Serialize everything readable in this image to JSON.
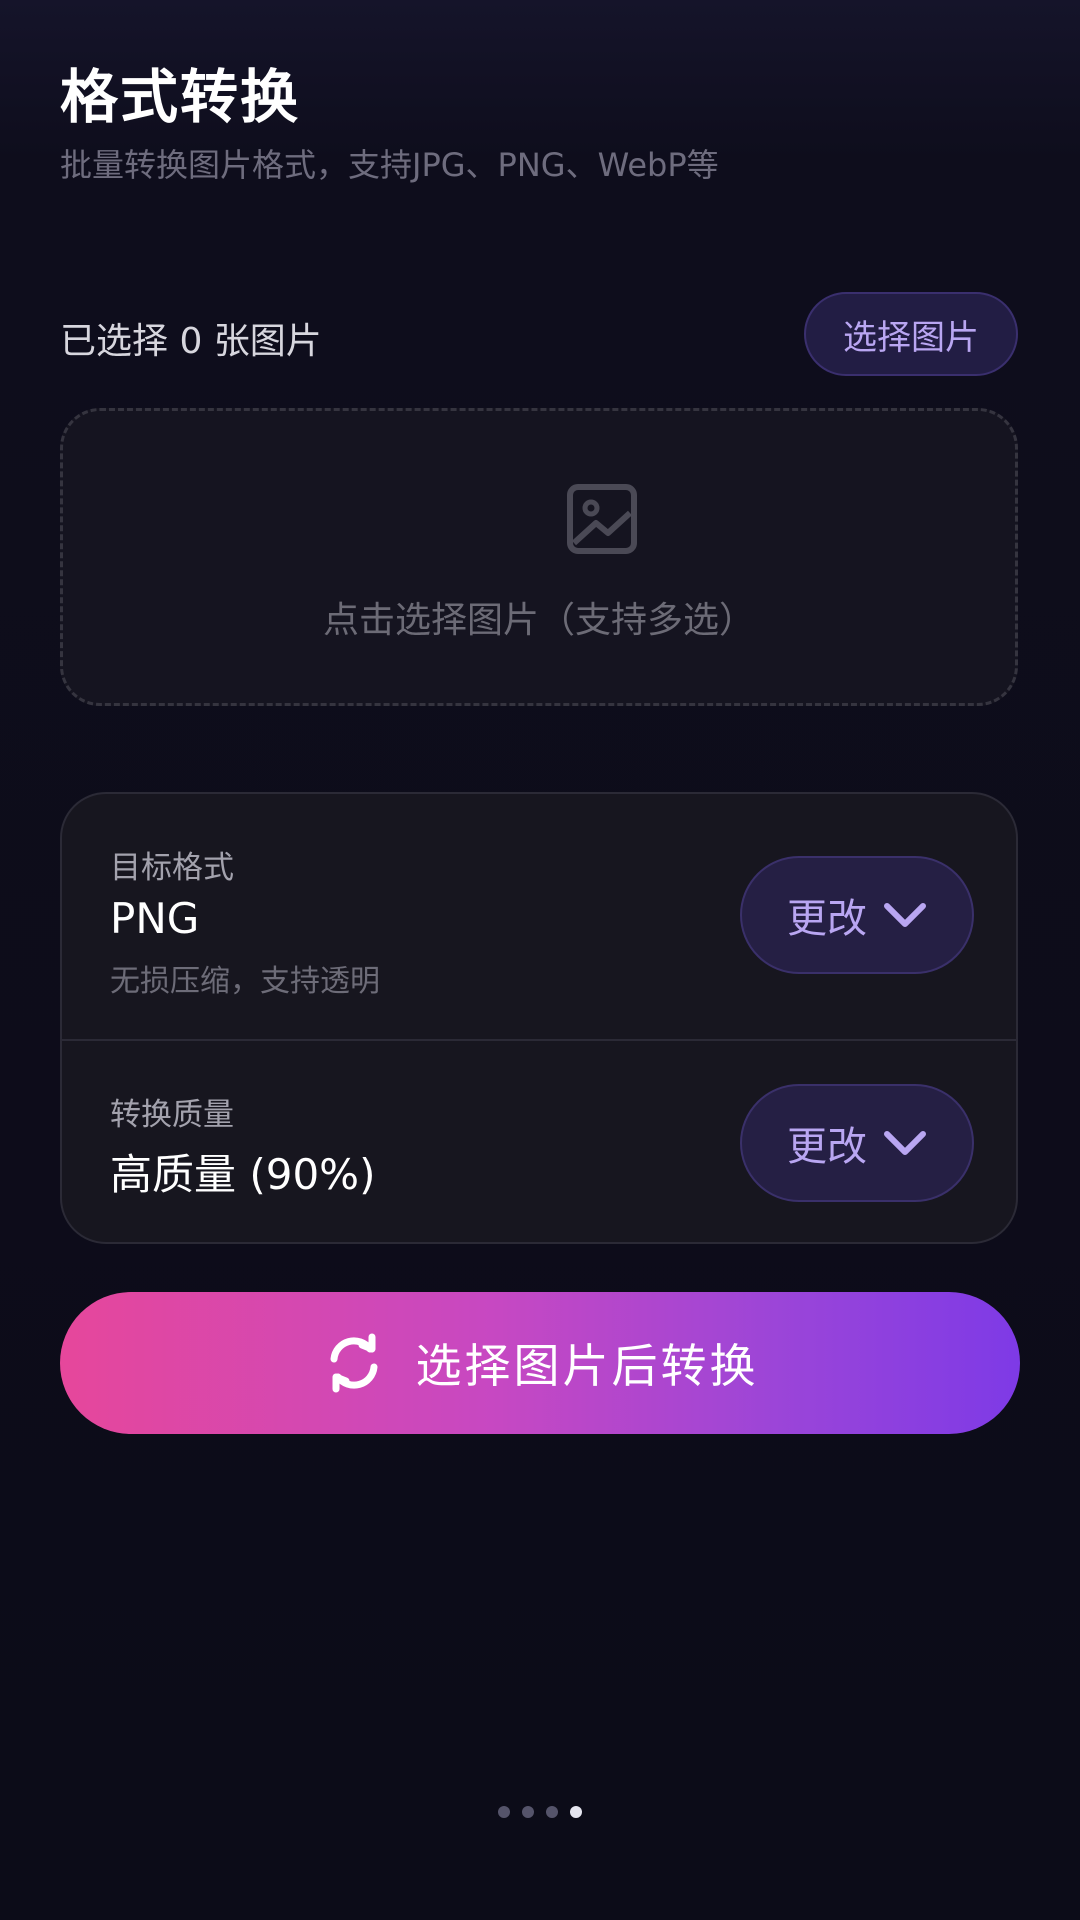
{
  "header": {
    "title": "格式转换",
    "subtitle": "批量转换图片格式，支持JPG、PNG、WebP等"
  },
  "selection": {
    "count_label": "已选择 0 张图片",
    "select_button": "选择图片"
  },
  "dropzone": {
    "icon": "image-icon",
    "hint": "点击选择图片（支持多选）"
  },
  "settings": {
    "format": {
      "label": "目标格式",
      "value": "PNG",
      "description": "无损压缩，支持透明",
      "button": "更改"
    },
    "quality": {
      "label": "转换质量",
      "value": "高质量 (90%)",
      "button": "更改"
    }
  },
  "convert_button": {
    "icon": "refresh-icon",
    "label": "选择图片后转换"
  },
  "pager": {
    "total": 4,
    "active_index": 3
  },
  "colors": {
    "background": "#0d0d1a",
    "accent": "#b9a6f2",
    "gradient_start": "#e6479b",
    "gradient_end": "#7e3ae6"
  }
}
